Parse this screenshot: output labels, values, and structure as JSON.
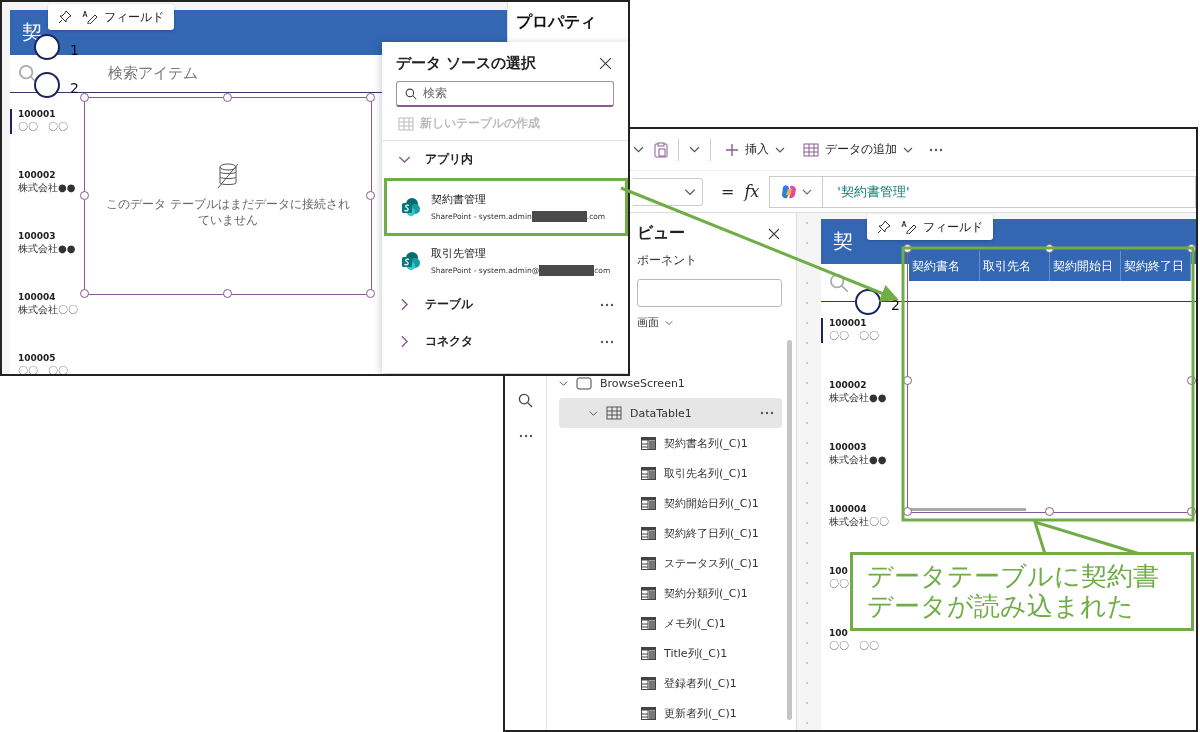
{
  "left_screenshot": {
    "app_title": "契",
    "field_toolbar": {
      "label": "フィールド"
    },
    "markers": [
      "1",
      "2"
    ],
    "search": {
      "placeholder": "検索アイテム"
    },
    "gallery": [
      {
        "id": "100001",
        "sub": "〇〇　〇〇",
        "selected": true
      },
      {
        "id": "100002",
        "sub": "株式会社●●",
        "selected": false
      },
      {
        "id": "100003",
        "sub": "株式会社●●",
        "selected": false
      },
      {
        "id": "100004",
        "sub": "株式会社〇〇",
        "selected": false
      },
      {
        "id": "100005",
        "sub": "〇〇　〇〇",
        "selected": false
      }
    ],
    "data_table": {
      "empty_message": "このデータ テーブルはまだデータに接続されていません"
    },
    "properties_title": "プロパティ",
    "data_source_panel": {
      "title": "データ ソースの選択",
      "search": {
        "placeholder": "検索"
      },
      "new_table": {
        "label": "新しいテーブルの作成",
        "disabled": true
      },
      "sections": [
        {
          "label": "アプリ内",
          "expanded": true,
          "items": [
            {
              "name": "契約書管理",
              "detail_prefix": "SharePoint - system.admin",
              "detail_suffix": ".com",
              "selected": true
            },
            {
              "name": "取引先管理",
              "detail_prefix": "SharePoint - system.admin@",
              "detail_suffix": "com",
              "selected": false
            }
          ]
        },
        {
          "label": "テーブル",
          "expanded": false
        },
        {
          "label": "コネクタ",
          "expanded": false
        }
      ]
    }
  },
  "right_screenshot": {
    "toolbar": {
      "insert_label": "挿入",
      "add_data_label": "データの追加"
    },
    "formula": {
      "equals": "=",
      "fx": "fx",
      "value": "'契約書管理'"
    },
    "tree_panel": {
      "title": "ビュー",
      "subtitle": "ポーネント",
      "screen_label": "画面",
      "nodes": [
        {
          "label": "BrowseScreen1",
          "kind": "screen",
          "expanded": true,
          "selected": false,
          "children": [
            {
              "label": "DataTable1",
              "kind": "table",
              "expanded": true,
              "selected": true,
              "children": [
                {
                  "label": "契約書名列(_C)1",
                  "kind": "column",
                  "selected": false
                },
                {
                  "label": "取引先名列(_C)1",
                  "kind": "column",
                  "selected": false
                },
                {
                  "label": "契約開始日列(_C)1",
                  "kind": "column",
                  "selected": false
                },
                {
                  "label": "契約終了日列(_C)1",
                  "kind": "column",
                  "selected": false
                },
                {
                  "label": "ステータス列(_C)1",
                  "kind": "column",
                  "selected": false
                },
                {
                  "label": "契約分類列(_C)1",
                  "kind": "column",
                  "selected": false
                },
                {
                  "label": "メモ列(_C)1",
                  "kind": "column",
                  "selected": false
                },
                {
                  "label": "Title列(_C)1",
                  "kind": "column",
                  "selected": false
                },
                {
                  "label": "登録者列(_C)1",
                  "kind": "column",
                  "selected": false
                },
                {
                  "label": "更新者列(_C)1",
                  "kind": "column",
                  "selected": false
                }
              ]
            }
          ]
        }
      ]
    },
    "canvas": {
      "app_title": "契",
      "field_toolbar_label": "フィールド",
      "columns": [
        "契約書名",
        "取引先名",
        "契約開始日",
        "契約終了日"
      ],
      "marker": "2",
      "gallery": [
        {
          "id": "100001",
          "sub": "〇〇　〇〇",
          "selected": true
        },
        {
          "id": "100002",
          "sub": "株式会社●●",
          "selected": false
        },
        {
          "id": "100003",
          "sub": "株式会社●●",
          "selected": false
        },
        {
          "id": "100004",
          "sub": "株式会社〇〇",
          "selected": false
        },
        {
          "id": "100",
          "sub": "〇〇",
          "selected": false
        },
        {
          "id": "100",
          "sub": "〇〇　〇〇",
          "selected": false
        }
      ]
    }
  },
  "callout": {
    "lines": [
      "データテーブルに契約書",
      "データが読み込まれた"
    ]
  }
}
